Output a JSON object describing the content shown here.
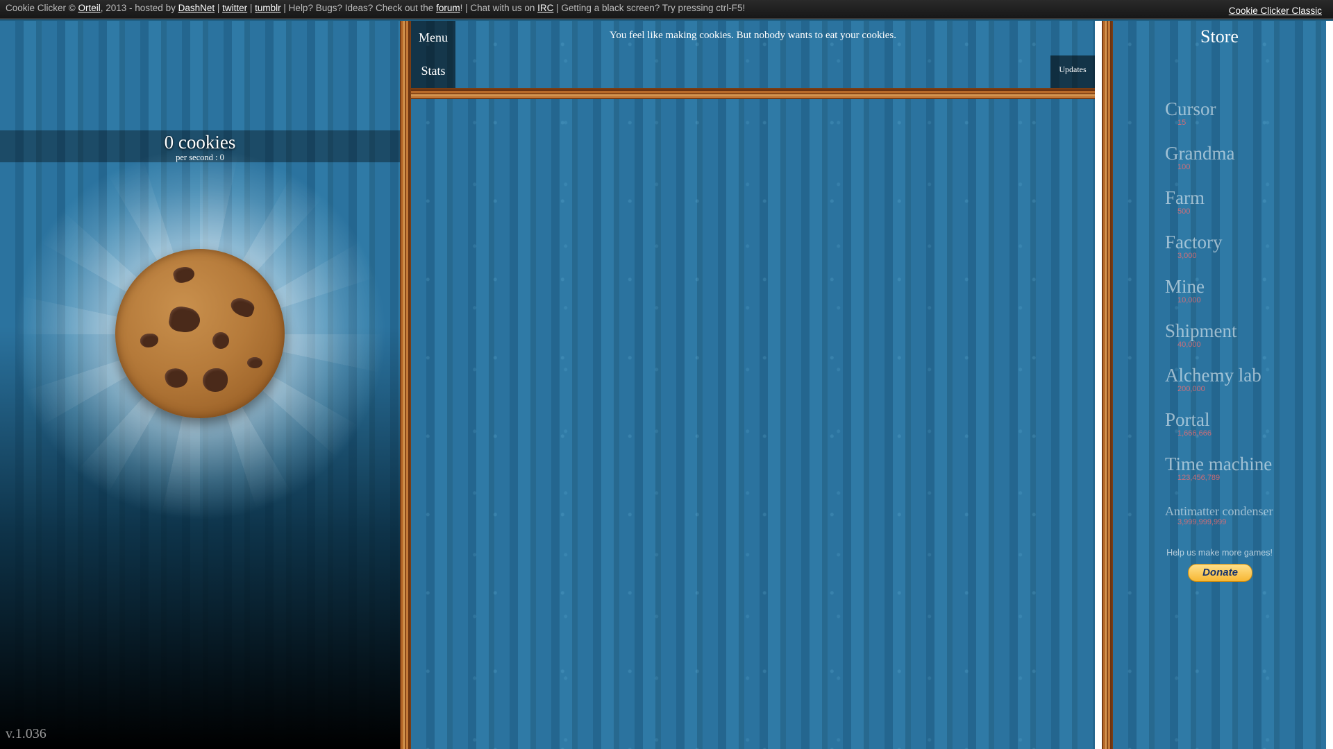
{
  "topbar": {
    "prefix": "Cookie Clicker © ",
    "author_link": "Orteil",
    "hosted_text": ", 2013 - hosted by ",
    "host_link": "DashNet",
    "sep1": " | ",
    "twitter_link": "twitter",
    "sep2": " | ",
    "tumblr_link": "tumblr",
    "help_text": " | Help? Bugs? Ideas? Check out the ",
    "forum_link": "forum",
    "chat_text": "! | Chat with us on ",
    "irc_link": "IRC",
    "black_screen_text": " | Getting a black screen? Try pressing ctrl-F5!",
    "classic_link": "Cookie Clicker Classic"
  },
  "left": {
    "cookie_count": "0 cookies",
    "per_second": "per second : 0",
    "version": "v.1.036"
  },
  "center": {
    "menu_label": "Menu",
    "stats_label": "Stats",
    "updates_label": "Updates",
    "news": "You feel like making cookies. But nobody wants to eat your cookies."
  },
  "store": {
    "title": "Store",
    "items": [
      {
        "name": "Cursor",
        "price": "15"
      },
      {
        "name": "Grandma",
        "price": "100"
      },
      {
        "name": "Farm",
        "price": "500"
      },
      {
        "name": "Factory",
        "price": "3,000"
      },
      {
        "name": "Mine",
        "price": "10,000"
      },
      {
        "name": "Shipment",
        "price": "40,000"
      },
      {
        "name": "Alchemy lab",
        "price": "200,000"
      },
      {
        "name": "Portal",
        "price": "1,666,666"
      },
      {
        "name": "Time machine",
        "price": "123,456,789"
      },
      {
        "name": "Antimatter condenser",
        "price": "3,999,999,999"
      }
    ],
    "donate_text": "Help us make more games!",
    "donate_button": "Donate"
  },
  "colors": {
    "background_blue": "#2c74a0",
    "price_red": "#ff6b6b",
    "topbar": "#1f1f1f"
  }
}
